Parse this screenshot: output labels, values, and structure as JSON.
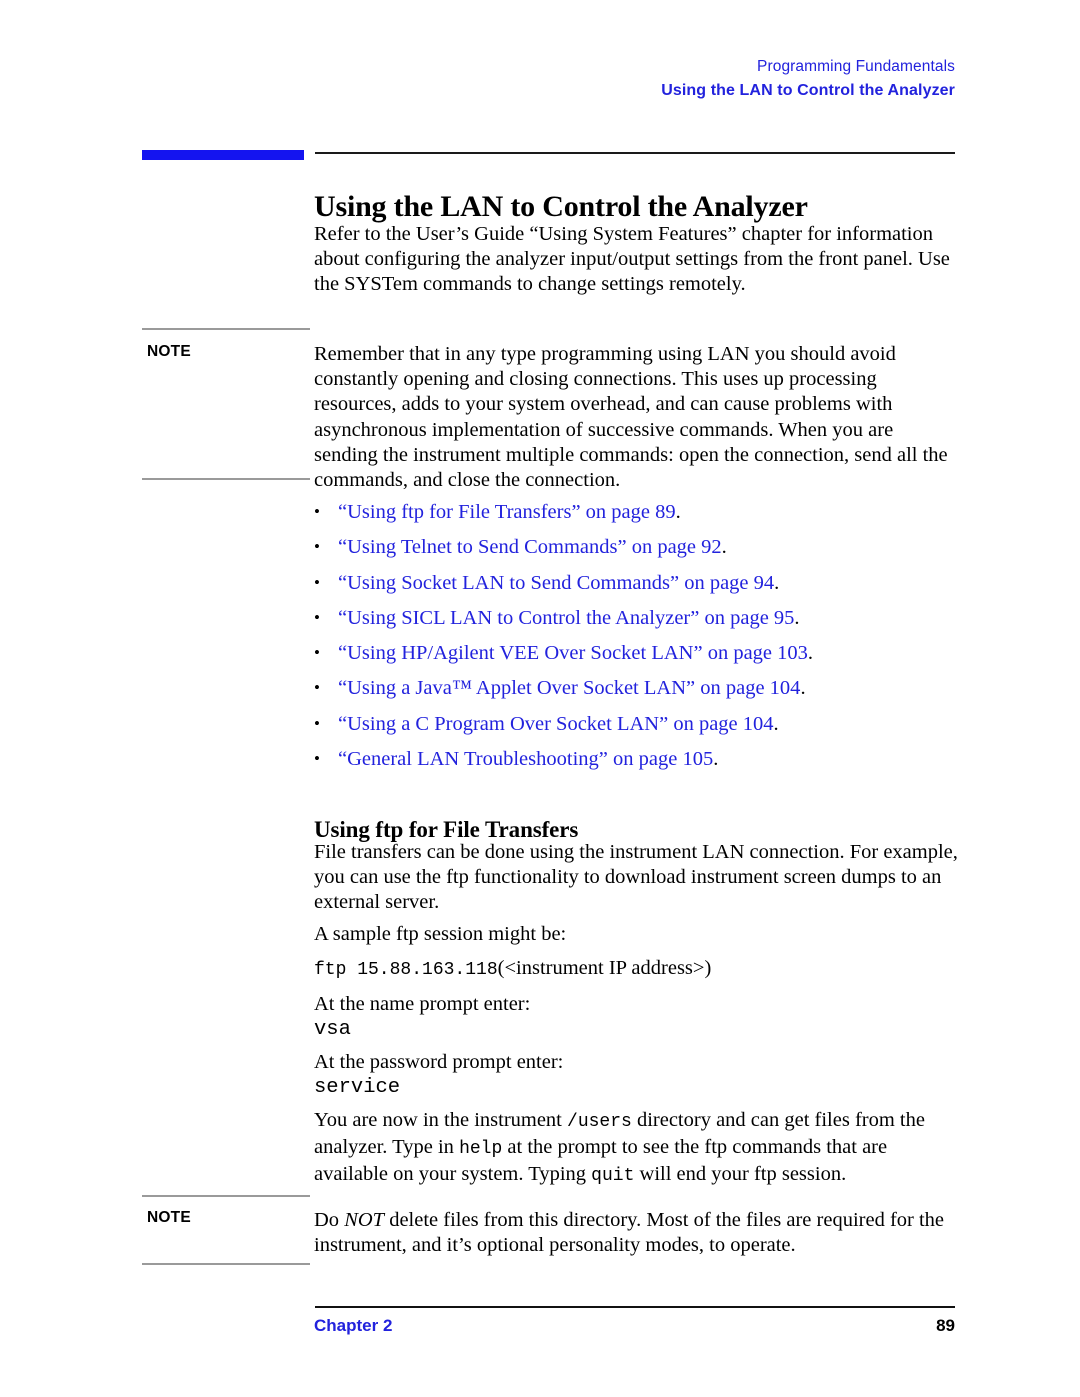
{
  "running_header": {
    "line1": "Programming Fundamentals",
    "line2": "Using the LAN to Control the Analyzer",
    "color": "#2222dd"
  },
  "title": {
    "text": "Using the LAN to Control the Analyzer",
    "accent_bar_color": "#1414f0",
    "rule_color": "#1a1a1a"
  },
  "intro_paragraph": "Refer to the User’s Guide “Using System Features” chapter for information about configuring the analyzer input/output settings from the front panel. Use the SYSTem commands to change settings remotely.",
  "note1": {
    "label": "NOTE",
    "text": "Remember that in any type programming using LAN you should avoid constantly opening and closing connections. This uses up processing resources, adds to your system overhead, and can cause problems with asynchronous implementation of successive commands. When you are sending the instrument multiple commands: open the connection, send all the commands, and close the connection."
  },
  "xref_list": [
    {
      "bullet": "•",
      "text": "“Using ftp for File Transfers” on page  89",
      "dot": "."
    },
    {
      "bullet": "•",
      "text": "“Using Telnet to Send Commands” on page  92",
      "dot": "."
    },
    {
      "bullet": "•",
      "text": "“Using Socket LAN to Send Commands” on page  94",
      "dot": "."
    },
    {
      "bullet": "•",
      "text": "“Using SICL LAN to Control the Analyzer” on page  95",
      "dot": "."
    },
    {
      "bullet": "•",
      "text": "“Using HP/Agilent VEE Over Socket LAN” on page  103",
      "dot": "."
    },
    {
      "bullet": "•",
      "text": "“Using a Java™ Applet Over Socket LAN” on page  104",
      "dot": "."
    },
    {
      "bullet": "•",
      "text": "“Using a C Program Over Socket LAN” on page  104",
      "dot": "."
    },
    {
      "bullet": "•",
      "text": "“General LAN Troubleshooting” on page  105",
      "dot": "."
    }
  ],
  "section": {
    "heading": "Using ftp for File Transfers",
    "para1": "File transfers can be done using the instrument LAN connection. For example, you can use the ftp functionality to download instrument screen dumps to an external server.",
    "para2": "A sample ftp session might be:",
    "ftp_command_mono": "ftp 15.88.163.118",
    "ftp_command_tail": "(<instrument IP address>)",
    "name_prompt": "At the name prompt enter:",
    "name_value": "vsa",
    "password_prompt": "At the password prompt enter:",
    "password_value": "service",
    "closing_part1": "You are now in the instrument ",
    "closing_mono1": "/users",
    "closing_part2": " directory and can get files from the analyzer. Type in ",
    "closing_mono2": "help",
    "closing_part3": " at the prompt to see the ftp commands that are available on your system. Typing ",
    "closing_mono3": "quit",
    "closing_part4": " will end your ftp session."
  },
  "note2": {
    "label": "NOTE",
    "part1": "Do ",
    "italic": "NOT",
    "part2": " delete files from this directory. Most of the files are required for the instrument, and it’s optional personality modes, to operate."
  },
  "footer": {
    "chapter": "Chapter 2",
    "page_number": "89",
    "chapter_color": "#2222dd"
  }
}
